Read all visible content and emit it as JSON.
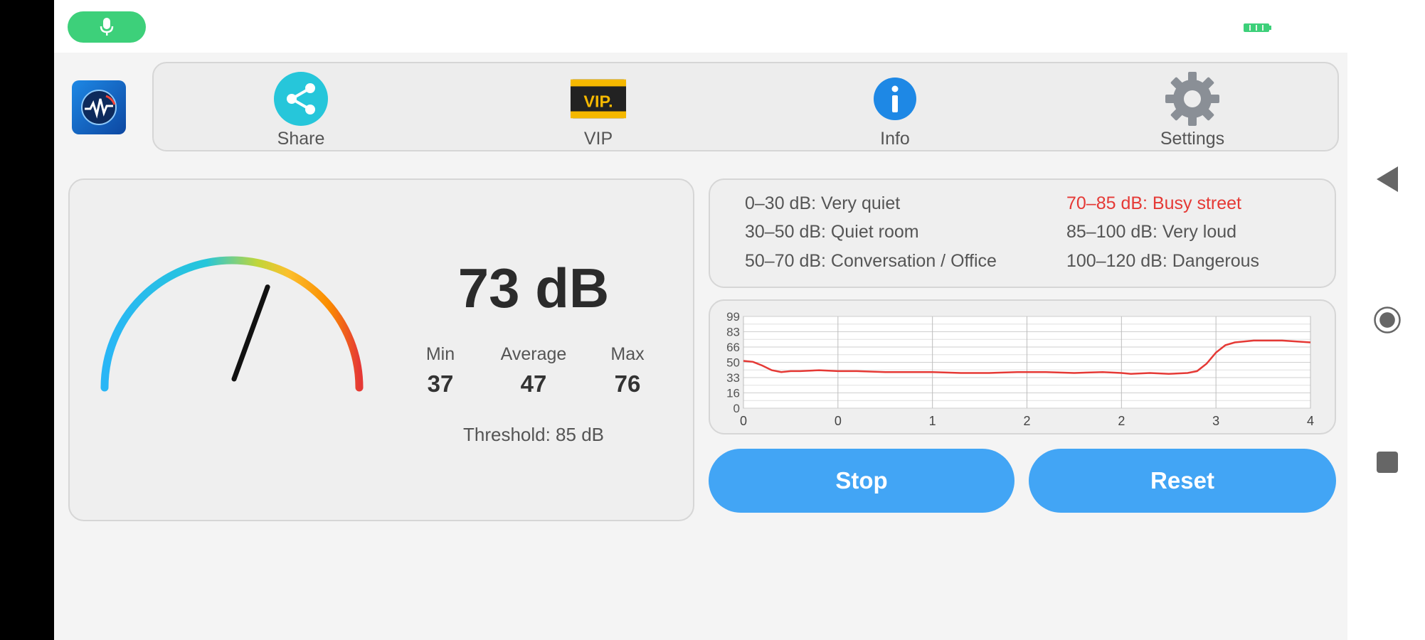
{
  "toolbar": {
    "share_label": "Share",
    "vip_label": "VIP",
    "vip_badge": "VIP.",
    "info_label": "Info",
    "settings_label": "Settings"
  },
  "meter": {
    "current": "73 dB",
    "needle_value_db": 73,
    "min_label": "Min",
    "min_value": "37",
    "avg_label": "Average",
    "avg_value": "47",
    "max_label": "Max",
    "max_value": "76",
    "threshold": "Threshold: 85 dB"
  },
  "legend": {
    "items": [
      "0–30 dB: Very quiet",
      "30–50 dB: Quiet room",
      "50–70 dB: Conversation / Office",
      "70–85 dB: Busy street",
      "85–100 dB: Very loud",
      "100–120 dB: Dangerous"
    ],
    "highlight_index": 3
  },
  "buttons": {
    "stop": "Stop",
    "reset": "Reset"
  },
  "colors": {
    "accent": "#42a5f5",
    "mic_indicator": "#3dd07a",
    "highlight": "#e53935",
    "line": "#e53935"
  },
  "chart_data": {
    "type": "line",
    "y_ticks": [
      "0",
      "16",
      "33",
      "50",
      "66",
      "83",
      "99"
    ],
    "x_ticks": [
      "0",
      "0",
      "1",
      "2",
      "2",
      "3",
      "4"
    ],
    "ylim": [
      0,
      99
    ],
    "xlim": [
      0,
      6
    ],
    "grid": true,
    "series": [
      {
        "x": [
          0,
          0.1,
          0.2,
          0.3,
          0.4,
          0.5,
          0.6,
          0.8,
          1.0,
          1.2,
          1.5,
          1.8,
          2.0,
          2.3,
          2.6,
          2.9,
          3.2,
          3.5,
          3.8,
          4.0,
          4.1,
          4.3,
          4.5,
          4.7,
          4.8,
          4.9,
          5.0,
          5.1,
          5.2,
          5.4,
          5.7,
          6.0
        ],
        "y": [
          51,
          50,
          46,
          41,
          39,
          40,
          40,
          41,
          40,
          40,
          39,
          39,
          39,
          38,
          38,
          39,
          39,
          38,
          39,
          38,
          37,
          38,
          37,
          38,
          40,
          48,
          60,
          68,
          71,
          73,
          73,
          71
        ]
      }
    ]
  }
}
